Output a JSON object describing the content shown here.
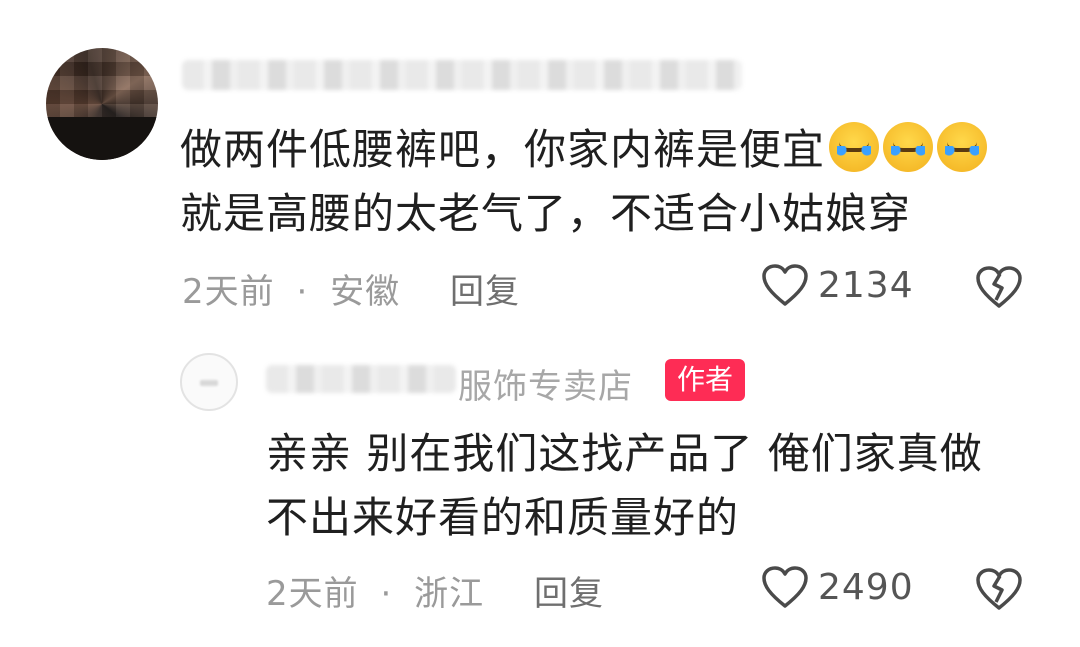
{
  "comments": [
    {
      "text_line1": "做两件低腰裤吧，你家内裤是便宜",
      "emojis": [
        "crying-face",
        "crying-face",
        "crying-face"
      ],
      "text_line2": "就是高腰的太老气了，不适合小姑娘穿",
      "time": "2天前",
      "location": "安徽",
      "reply_label": "回复",
      "likes": "2134"
    },
    {
      "shop_name_visible": "服饰专卖店",
      "badge": "作者",
      "text_line1": "亲亲 别在我们这找产品了 俺们家真做",
      "text_line2": "不出来好看的和质量好的",
      "time": "2天前",
      "location": "浙江",
      "reply_label": "回复",
      "likes": "2490"
    }
  ],
  "separator": "·",
  "colors": {
    "accent": "#fe2c55",
    "meta": "#9a9a9a"
  }
}
